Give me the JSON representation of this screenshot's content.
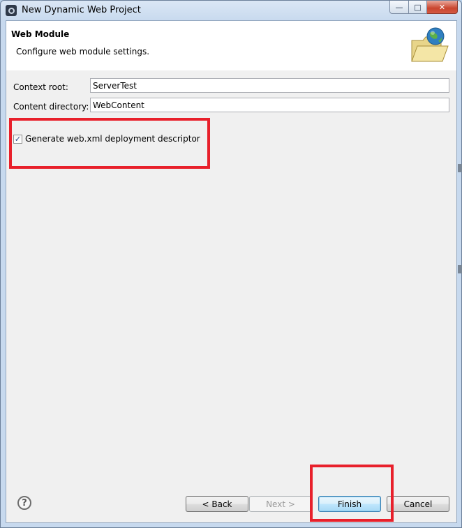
{
  "window": {
    "title": "New Dynamic Web Project",
    "minimize": "—",
    "maximize": "□",
    "close": "✕"
  },
  "banner": {
    "title": "Web Module",
    "description": "Configure web module settings.",
    "icon": "web-project-folder-globe-icon"
  },
  "form": {
    "context_root_label": "Context root:",
    "context_root_value": "ServerTest",
    "content_directory_label": "Content directory:",
    "content_directory_value": "WebContent",
    "generate_descriptor_label": "Generate web.xml deployment descriptor",
    "generate_descriptor_checked": true
  },
  "buttons": {
    "help": "?",
    "back": "< Back",
    "next": "Next >",
    "finish": "Finish",
    "cancel": "Cancel"
  },
  "colors": {
    "highlight": "#e8202b",
    "default_button": "#3c7fb1"
  }
}
